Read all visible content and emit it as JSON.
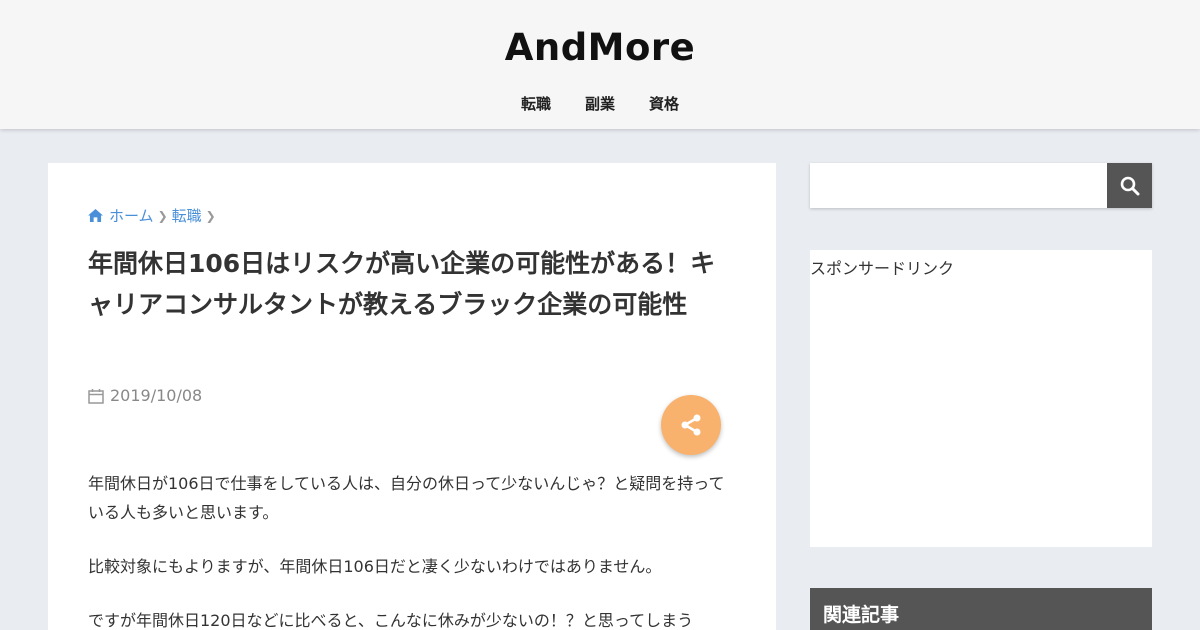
{
  "site": {
    "logo": "AndMore",
    "nav": [
      "転職",
      "副業",
      "資格"
    ]
  },
  "article": {
    "breadcrumb": {
      "home": "ホーム",
      "category": "転職"
    },
    "title": "年間休日106日はリスクが高い企業の可能性がある！キャリアコンサルタントが教えるブラック企業の可能性",
    "date": "2019/10/08",
    "paragraphs": [
      "年間休日が106日で仕事をしている人は、自分の休日って少ないんじゃ？と疑問を持っている人も多いと思います。",
      "比較対象にもよりますが、年間休日106日だと凄く少ないわけではありません。",
      "ですが年間休日120日などに比べると、こんなに休みが少ないの！？と思ってしまう"
    ]
  },
  "sidebar": {
    "search_placeholder": "",
    "sponsor_label": "スポンサードリンク",
    "related_title": "関連記事"
  },
  "colors": {
    "share_button": "#f9b26d",
    "link": "#4a90d9",
    "search_button": "#555555"
  }
}
